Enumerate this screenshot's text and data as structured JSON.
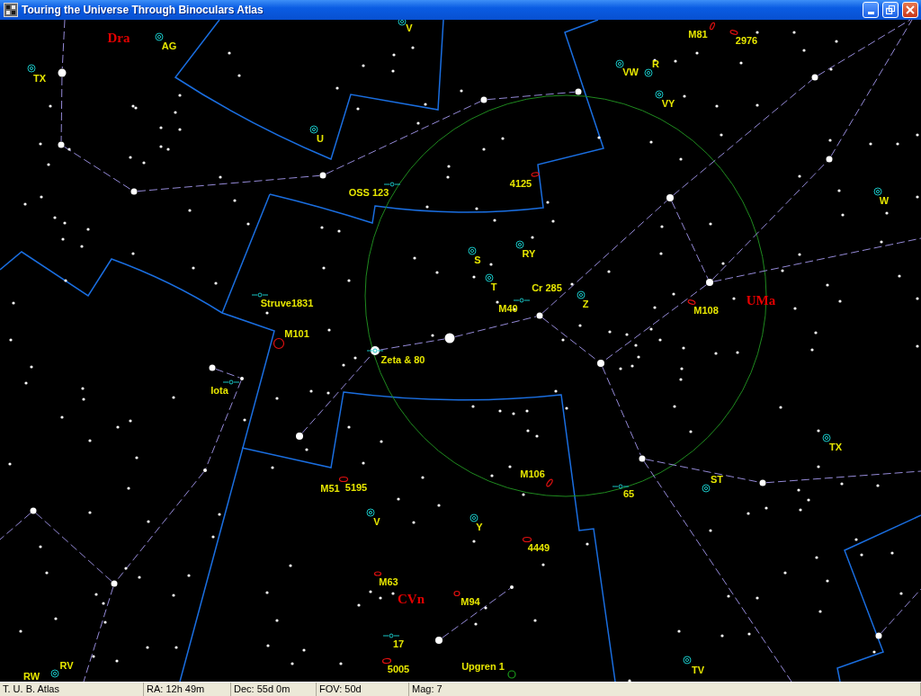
{
  "window": {
    "title": "Touring the Universe Through Binoculars Atlas"
  },
  "chart": {
    "objects": [
      {
        "kind": "variable",
        "label": "V"
      },
      {
        "kind": "constellation",
        "label": "Dra"
      },
      {
        "kind": "galaxy",
        "label": "M81"
      },
      {
        "kind": "galaxy",
        "label": "2976"
      },
      {
        "kind": "variable",
        "label": "AG"
      },
      {
        "kind": "variable",
        "label": "R"
      },
      {
        "kind": "variable",
        "label": "VW"
      },
      {
        "kind": "variable",
        "label": "TX"
      },
      {
        "kind": "variable",
        "label": "VY"
      },
      {
        "kind": "variable",
        "label": "U"
      },
      {
        "kind": "galaxy",
        "label": "4125"
      },
      {
        "kind": "double",
        "label": "OSS 123"
      },
      {
        "kind": "variable",
        "label": "W"
      },
      {
        "kind": "variable",
        "label": "RY"
      },
      {
        "kind": "variable",
        "label": "S"
      },
      {
        "kind": "variable",
        "label": "T"
      },
      {
        "kind": "unmarked",
        "label": "Cr 285"
      },
      {
        "kind": "double",
        "label": "Struve1831"
      },
      {
        "kind": "double",
        "label": "M40"
      },
      {
        "kind": "variable",
        "label": "Z"
      },
      {
        "kind": "galaxy",
        "label": "M108"
      },
      {
        "kind": "constellation",
        "label": "UMa"
      },
      {
        "kind": "galaxy",
        "label": "M101"
      },
      {
        "kind": "double",
        "label": "Zeta & 80"
      },
      {
        "kind": "double",
        "label": "Iota"
      },
      {
        "kind": "variable",
        "label": "TX"
      },
      {
        "kind": "galaxy",
        "label": "M106"
      },
      {
        "kind": "variable",
        "label": "ST"
      },
      {
        "kind": "galaxy",
        "label": "M51"
      },
      {
        "kind": "unmarked",
        "label": "5195"
      },
      {
        "kind": "double",
        "label": "65"
      },
      {
        "kind": "variable",
        "label": "V"
      },
      {
        "kind": "variable",
        "label": "Y"
      },
      {
        "kind": "galaxy",
        "label": "4449"
      },
      {
        "kind": "galaxy",
        "label": "M63"
      },
      {
        "kind": "constellation",
        "label": "CVn"
      },
      {
        "kind": "galaxy",
        "label": "M94"
      },
      {
        "kind": "double",
        "label": "17"
      },
      {
        "kind": "variable",
        "label": "RV"
      },
      {
        "kind": "galaxy",
        "label": "5005"
      },
      {
        "kind": "cluster",
        "label": "Upgren 1"
      },
      {
        "kind": "variable",
        "label": "TV"
      },
      {
        "kind": "unmarked",
        "label": "RW"
      }
    ]
  },
  "status_bar": {
    "panels": [
      "T. U. B. Atlas",
      "RA: 12h 49m",
      "Dec: 55d 0m",
      "FOV: 50d",
      "Mag: 7"
    ]
  }
}
